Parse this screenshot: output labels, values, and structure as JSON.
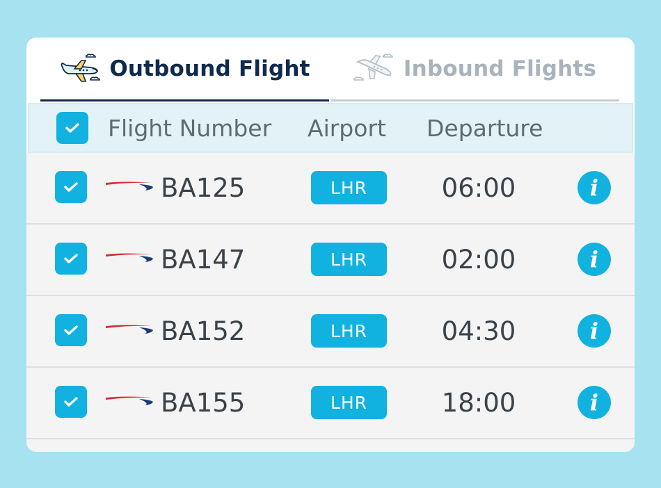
{
  "tabs": {
    "outbound": {
      "label": "Outbound Flight",
      "icon": "airplane-icon",
      "active": true
    },
    "inbound": {
      "label": "Inbound Flights",
      "icon": "airplane-icon",
      "active": false
    }
  },
  "table": {
    "headers": {
      "flight_number": "Flight Number",
      "airport": "Airport",
      "departure": "Departure"
    },
    "select_all_checked": true,
    "rows": [
      {
        "checked": true,
        "airline_logo": "ba-speedmarque-logo",
        "flight_number": "BA125",
        "airport": "LHR",
        "departure": "06:00",
        "info_icon": "info-icon"
      },
      {
        "checked": true,
        "airline_logo": "ba-speedmarque-logo",
        "flight_number": "BA147",
        "airport": "LHR",
        "departure": "02:00",
        "info_icon": "info-icon"
      },
      {
        "checked": true,
        "airline_logo": "ba-speedmarque-logo",
        "flight_number": "BA152",
        "airport": "LHR",
        "departure": "04:30",
        "info_icon": "info-icon"
      },
      {
        "checked": true,
        "airline_logo": "ba-speedmarque-logo",
        "flight_number": "BA155",
        "airport": "LHR",
        "departure": "18:00",
        "info_icon": "info-icon"
      }
    ]
  },
  "colors": {
    "page_background": "#a6e2ef",
    "accent": "#11b2df",
    "active_tab_text": "#0f2a4d",
    "inactive_tab_text": "#a9b3bd",
    "header_background": "#e2f2f6",
    "row_background": "#f4f4f5"
  }
}
